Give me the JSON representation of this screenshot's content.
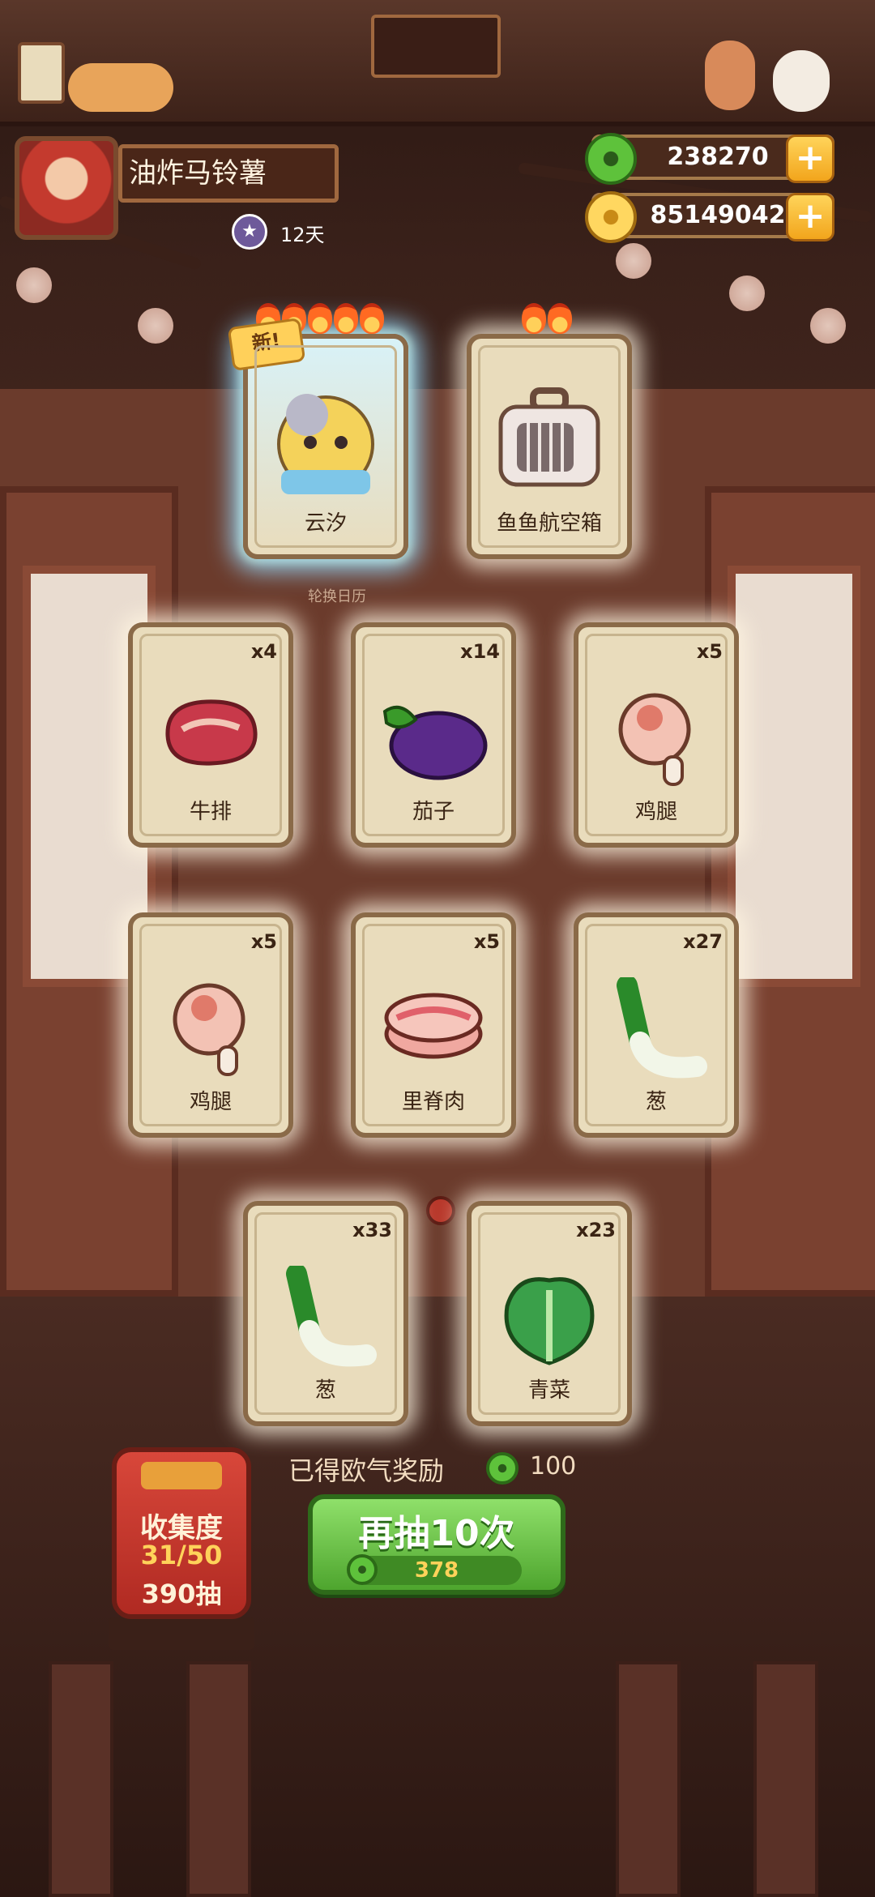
{
  "player": {
    "name": "油炸马铃薯",
    "days_label": "12天"
  },
  "currencies": [
    {
      "name": "jade",
      "value": "238270",
      "icon": "jade-icon",
      "plus": "+"
    },
    {
      "name": "coin",
      "value": "85149042",
      "icon": "coin-icon",
      "plus": "+"
    }
  ],
  "featured": [
    {
      "label": "云汐",
      "flames": 5,
      "new_tag": "新!",
      "rare": true,
      "icon": "cat-character-icon"
    },
    {
      "label": "鱼鱼航空箱",
      "flames": 2,
      "icon": "pet-carrier-icon"
    }
  ],
  "calendar_text": "轮换日历",
  "cards": [
    {
      "label": "牛排",
      "qty": "x4",
      "icon": "steak-icon"
    },
    {
      "label": "茄子",
      "qty": "x14",
      "icon": "eggplant-icon"
    },
    {
      "label": "鸡腿",
      "qty": "x5",
      "icon": "drumstick-icon"
    },
    {
      "label": "鸡腿",
      "qty": "x5",
      "icon": "drumstick-icon"
    },
    {
      "label": "里脊肉",
      "qty": "x5",
      "icon": "tenderloin-icon"
    },
    {
      "label": "葱",
      "qty": "x27",
      "icon": "scallion-icon"
    },
    {
      "label": "葱",
      "qty": "x33",
      "icon": "scallion-icon"
    },
    {
      "label": "青菜",
      "qty": "x23",
      "icon": "greens-icon"
    }
  ],
  "bonus": {
    "text": "已得欧气奖励",
    "value": "100"
  },
  "collection": {
    "title": "收集度",
    "progress": "31/50",
    "draws": "390抽"
  },
  "draw_button": {
    "label": "再抽10次",
    "cost": "378"
  },
  "colors": {
    "jade": "#5ec23b",
    "coin": "#ffd760",
    "button_green": "#4ea52e",
    "card_bg": "#e9dcbc"
  }
}
